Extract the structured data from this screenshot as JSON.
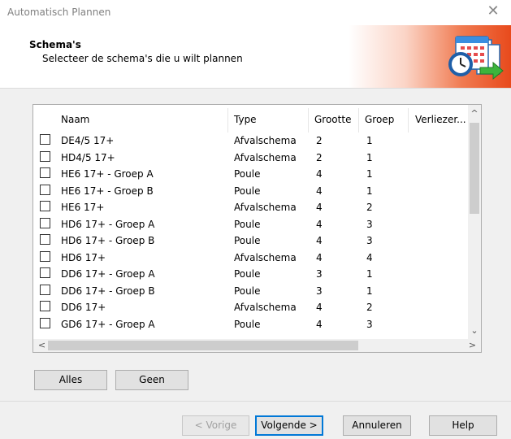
{
  "window": {
    "title": "Automatisch Plannen",
    "close_glyph": "✕"
  },
  "header": {
    "title": "Schema's",
    "subtitle": "Selecteer de schema's die u wilt plannen",
    "logo_icon": "calendar-clock-icon"
  },
  "table": {
    "columns": [
      "Naam",
      "Type",
      "Grootte",
      "Groep",
      "Verliezer..."
    ],
    "rows": [
      {
        "naam": "DE4/5 17+",
        "type": "Afvalschema",
        "grootte": "2",
        "groep": "1"
      },
      {
        "naam": "HD4/5 17+",
        "type": "Afvalschema",
        "grootte": "2",
        "groep": "1"
      },
      {
        "naam": "HE6 17+ - Groep A",
        "type": "Poule",
        "grootte": "4",
        "groep": "1"
      },
      {
        "naam": "HE6 17+ - Groep B",
        "type": "Poule",
        "grootte": "4",
        "groep": "1"
      },
      {
        "naam": "HE6 17+",
        "type": "Afvalschema",
        "grootte": "4",
        "groep": "2"
      },
      {
        "naam": "HD6 17+ - Groep A",
        "type": "Poule",
        "grootte": "4",
        "groep": "3"
      },
      {
        "naam": "HD6 17+ - Groep B",
        "type": "Poule",
        "grootte": "4",
        "groep": "3"
      },
      {
        "naam": "HD6 17+",
        "type": "Afvalschema",
        "grootte": "4",
        "groep": "4"
      },
      {
        "naam": "DD6 17+ - Groep A",
        "type": "Poule",
        "grootte": "3",
        "groep": "1"
      },
      {
        "naam": "DD6 17+ - Groep B",
        "type": "Poule",
        "grootte": "3",
        "groep": "1"
      },
      {
        "naam": "DD6 17+",
        "type": "Afvalschema",
        "grootte": "4",
        "groep": "2"
      },
      {
        "naam": "GD6 17+ - Groep A",
        "type": "Poule",
        "grootte": "4",
        "groep": "3"
      }
    ]
  },
  "scroll": {
    "up": "^",
    "down": "⌄",
    "left": "<",
    "right": ">"
  },
  "buttons": {
    "alles": "Alles",
    "geen": "Geen",
    "vorige": "< Vorige",
    "volgende": "Volgende >",
    "annuleren": "Annuleren",
    "help": "Help"
  }
}
